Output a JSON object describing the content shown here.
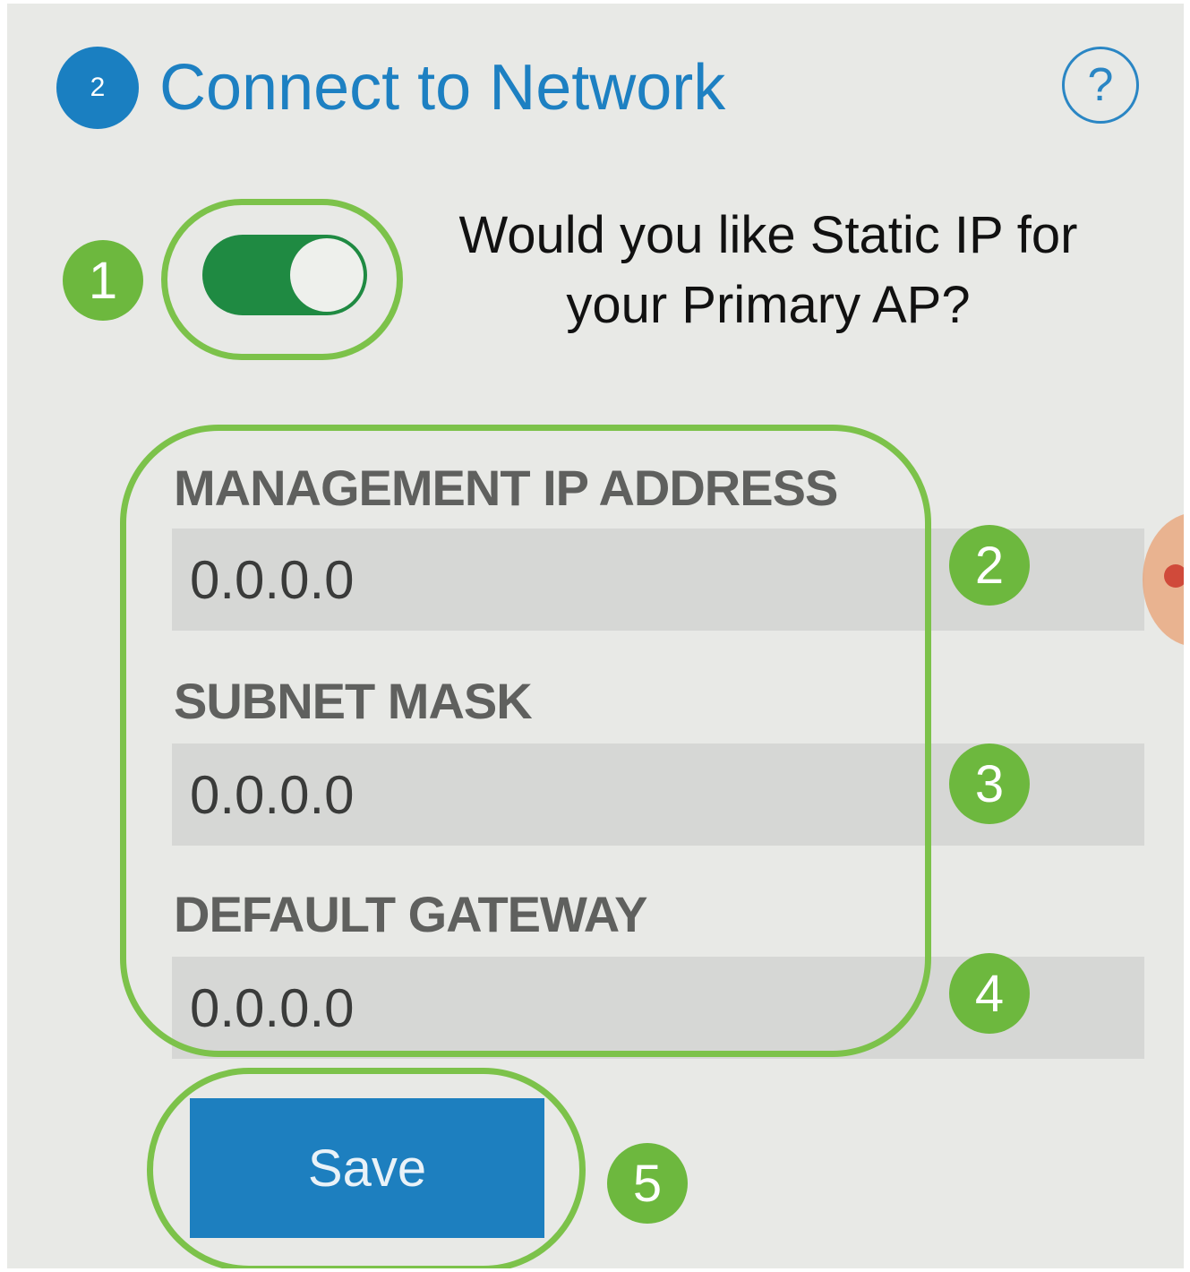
{
  "header": {
    "step_number": "2",
    "title": "Connect to Network",
    "help_label": "?"
  },
  "static_ip": {
    "question": "Would you like Static IP for your Primary AP?",
    "enabled": true
  },
  "fields": [
    {
      "label": "MANAGEMENT IP ADDRESS",
      "value": "0.0.0.0"
    },
    {
      "label": "SUBNET MASK",
      "value": "0.0.0.0"
    },
    {
      "label": "DEFAULT GATEWAY",
      "value": "0.0.0.0"
    }
  ],
  "save_label": "Save",
  "callouts": [
    "1",
    "2",
    "3",
    "4",
    "5"
  ],
  "colors": {
    "accent_blue": "#1a7fc1",
    "toggle_green": "#1f8a42",
    "callout_green": "#6db83e"
  }
}
